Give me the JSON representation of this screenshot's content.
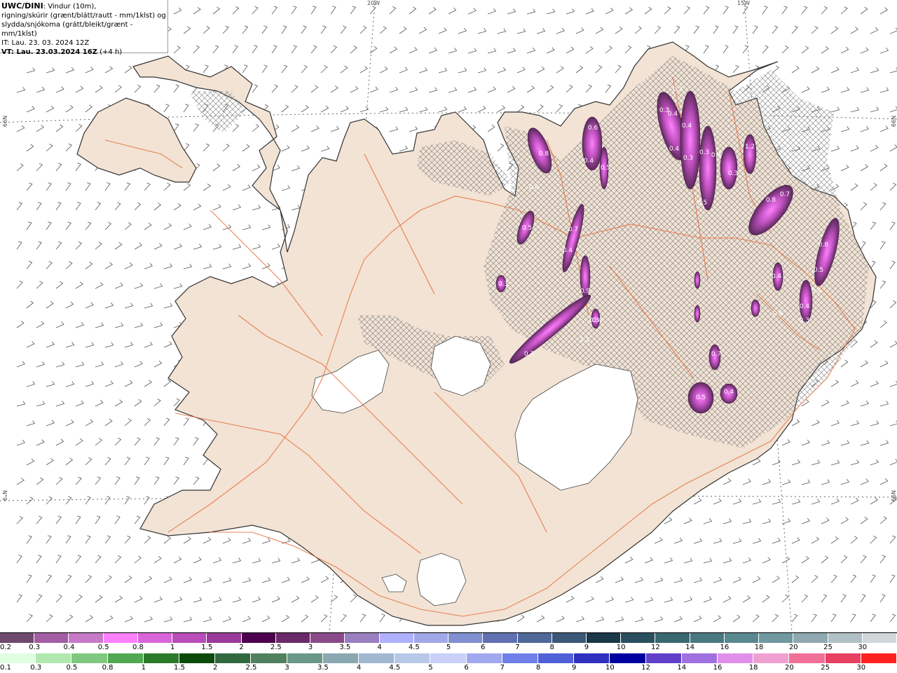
{
  "info": {
    "model": "UWC/DINI",
    "line1_rest": ": Vindur (10m),",
    "line2": "rigning/skúrir (grænt/blátt/rautt - mm/1klst) og",
    "line3": "slydda/snjókoma (grátt/bleikt/grænt - mm/1klst)",
    "it": "IT: Lau. 23. 03. 2024 12Z",
    "vt": "VT: Lau. 23.03.2024 16Z",
    "vt_offset": " (+4 h)"
  },
  "graticule": {
    "lon_labels": [
      "20W",
      "15W"
    ],
    "lat_labels_left": [
      "N99",
      "N°9"
    ],
    "lat_labels_right": [
      "N99",
      "N99"
    ]
  },
  "precip_labels": [
    "0.3",
    "0.5",
    "0.4",
    "0.8",
    "0.4",
    "0.7",
    "0.9",
    "0.6",
    "0.4",
    "0.5",
    "0.4",
    "0.7",
    "1.1",
    "0.5",
    "0.3",
    "0.4",
    "0.3",
    "0.4",
    "0.4",
    "0.3",
    "0.3",
    "0.4",
    "0.3",
    "0.5",
    "1.2",
    "0.8",
    "0.7",
    "0.8",
    "0.5",
    "0.4",
    "0.6",
    "0.4",
    "0.4",
    "0.3",
    "0.7",
    "0.5",
    "0.4",
    "0.3"
  ],
  "legend_snow": {
    "labels": [
      "0.2",
      "0.3",
      "0.4",
      "0.5",
      "0.8",
      "1",
      "1.5",
      "2",
      "2.5",
      "3",
      "3.5",
      "4",
      "4.5",
      "5",
      "6",
      "7",
      "8",
      "9",
      "10",
      "12",
      "14",
      "16",
      "18",
      "20",
      "25",
      "30"
    ],
    "colors": [
      "#6e4a6e",
      "#a35ea3",
      "#c77ac7",
      "#ff80ff",
      "#d966d9",
      "#b94db9",
      "#9b3a9b",
      "#4d004d",
      "#6a2a6a",
      "#8a4a8a",
      "#9a80c0",
      "#b0b0ff",
      "#a0a8e8",
      "#8090d0",
      "#6070b0",
      "#506898",
      "#3a5878",
      "#1a3848",
      "#2a5060",
      "#3a6870",
      "#4a7880",
      "#5a8890",
      "#7098a0",
      "#90a8b0",
      "#b0c0c4",
      "#d0d8da"
    ]
  },
  "legend_rain": {
    "labels": [
      "0.1",
      "0.3",
      "0.5",
      "0.8",
      "1",
      "1.5",
      "2",
      "2.5",
      "3",
      "3.5",
      "4",
      "4.5",
      "5",
      "6",
      "7",
      "8",
      "9",
      "10",
      "12",
      "14",
      "16",
      "18",
      "20",
      "25",
      "30"
    ],
    "colors": [
      "#e0ffe0",
      "#b0e8b0",
      "#80c880",
      "#50a850",
      "#2a7a2a",
      "#0a4a0a",
      "#306840",
      "#508060",
      "#6a9888",
      "#8aa8b0",
      "#a0b8d0",
      "#b8c8e8",
      "#c8d0f8",
      "#a0a8f0",
      "#7080e8",
      "#5060d8",
      "#3030c0",
      "#0000a0",
      "#6040c8",
      "#a070e0",
      "#e090e8",
      "#f0a0d0",
      "#f07098",
      "#e84060",
      "#ff2020"
    ]
  },
  "colors": {
    "land": "#f2e3d5",
    "road": "#e8703a",
    "coast": "#3a3a3a",
    "glacier": "#ffffff",
    "hatch": "#777777"
  }
}
